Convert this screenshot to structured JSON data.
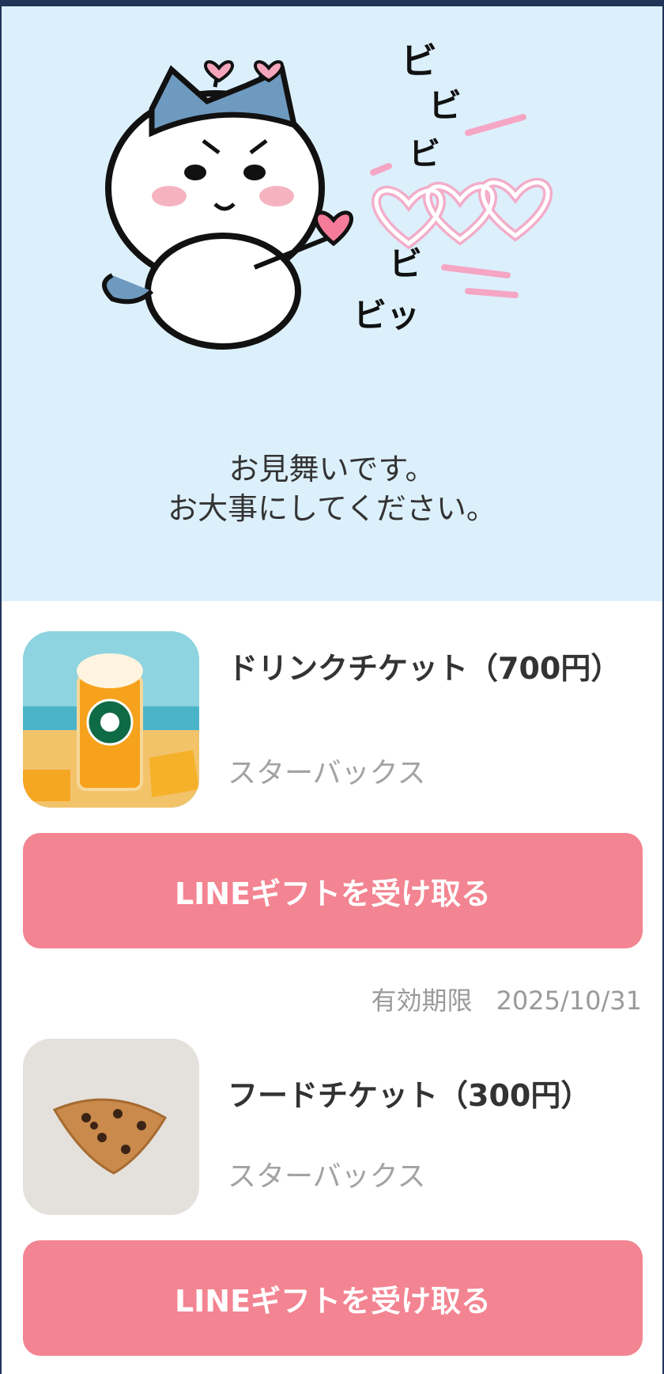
{
  "hero": {
    "line1": "お見舞いです。",
    "line2": "お大事にしてください。",
    "sfx": [
      "ビ",
      "ビ",
      "ビ",
      "ビ",
      "ビッ"
    ]
  },
  "gifts": [
    {
      "title": "ドリンクチケット（700円）",
      "brand": "スターバックス",
      "button": "LINEギフトを受け取る",
      "expiry_label": "有効期限",
      "expiry_date": "2025/10/31"
    },
    {
      "title": "フードチケット（300円）",
      "brand": "スターバックス",
      "button": "LINEギフトを受け取る"
    }
  ],
  "colors": {
    "hero_bg": "#dcf0fc",
    "button": "#f38491",
    "frame": "#1f3457"
  }
}
